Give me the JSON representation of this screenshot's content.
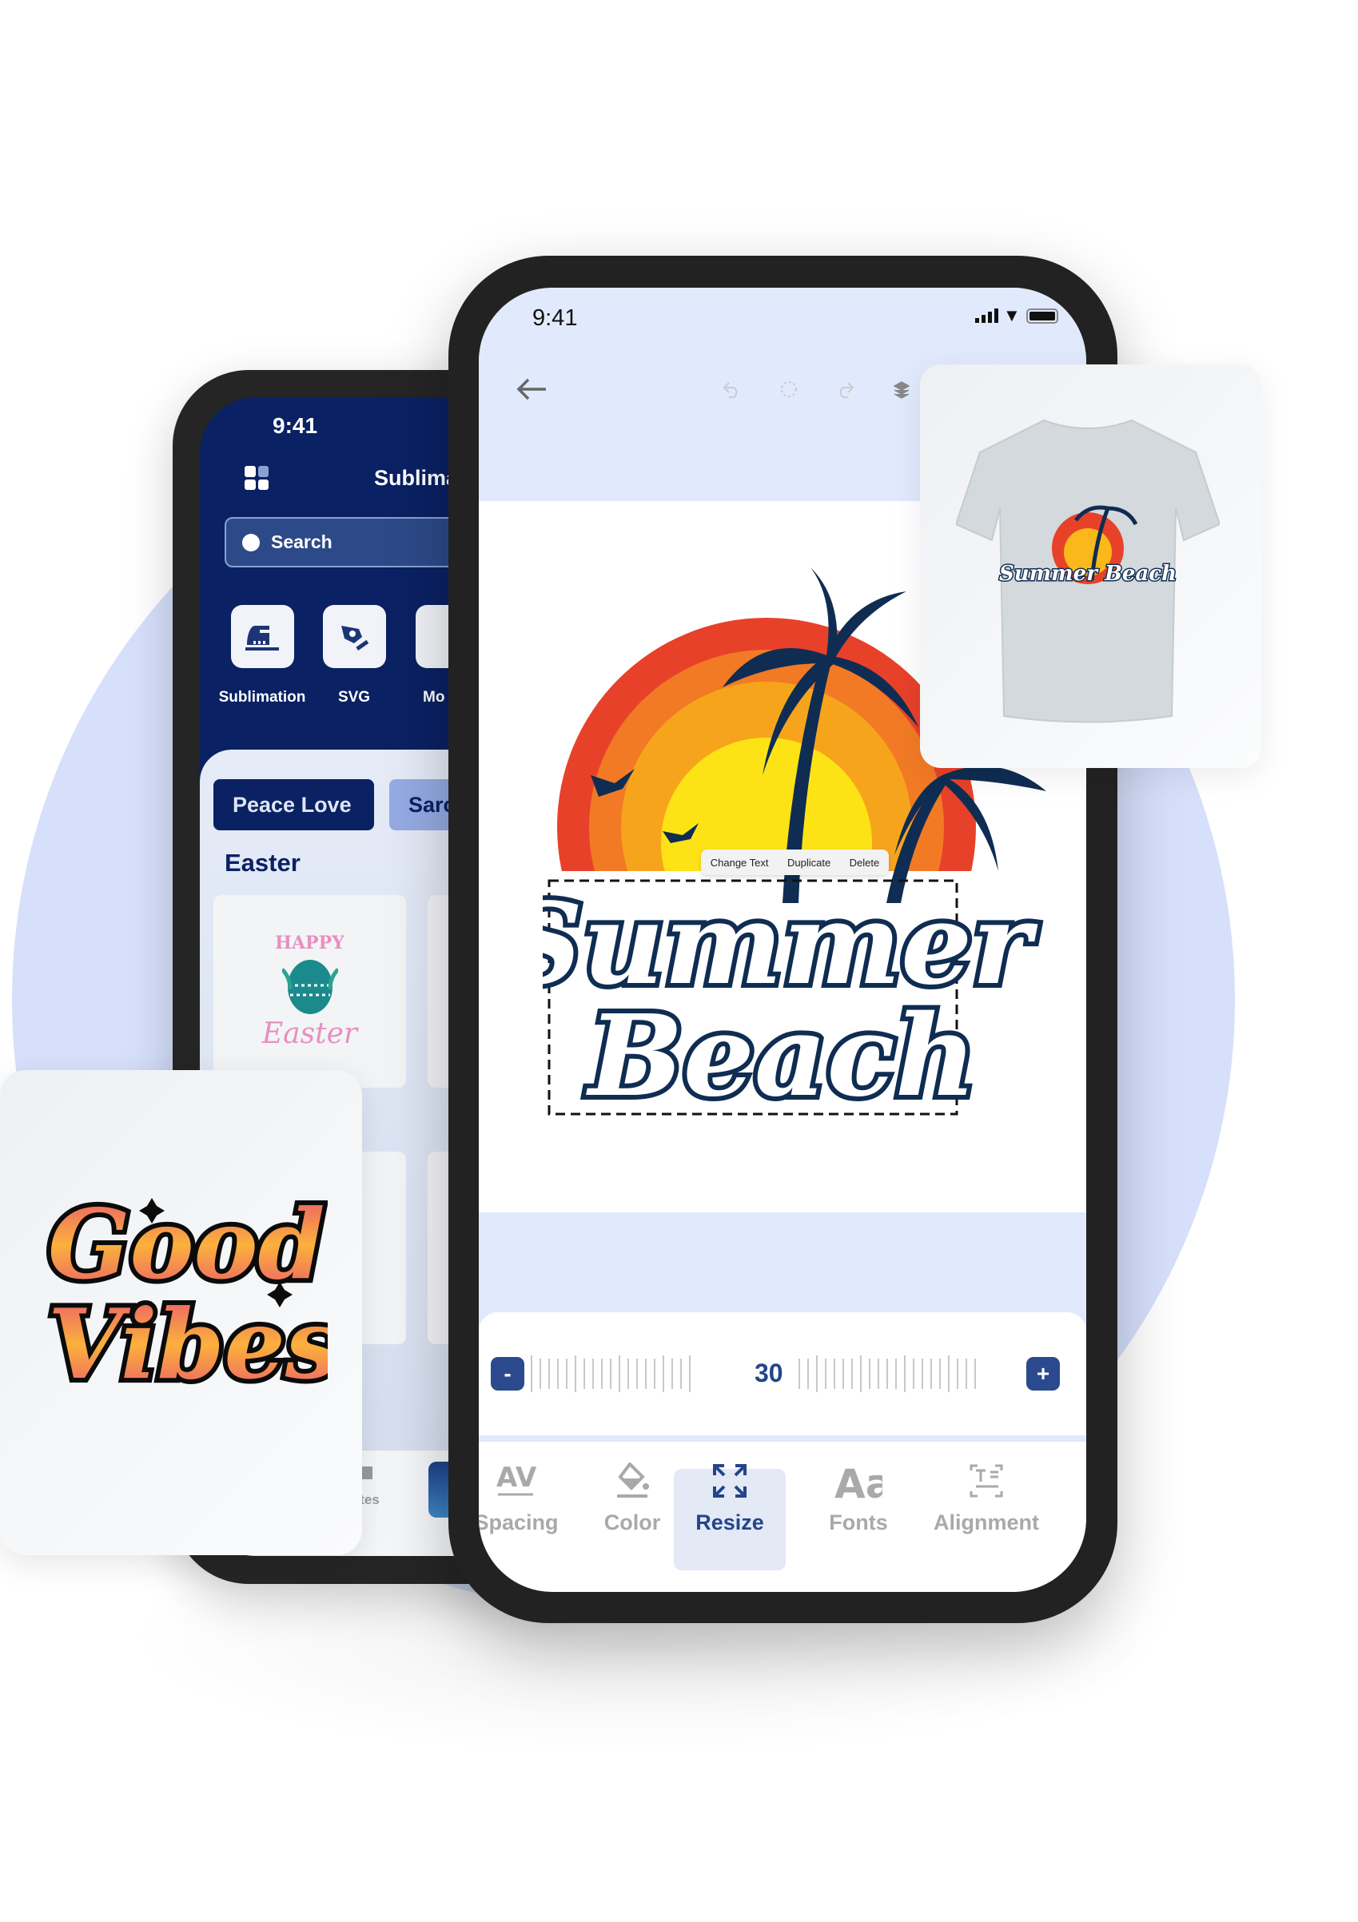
{
  "back_phone": {
    "status_time": "9:41",
    "app_title": "Sublima",
    "search_placeholder": "Search",
    "categories": [
      {
        "label": "Sublimation",
        "icon": "iron-icon"
      },
      {
        "label": "SVG",
        "icon": "pen-tool-icon"
      },
      {
        "label": "Mo",
        "icon": "mockup-icon"
      }
    ],
    "chips": [
      "Peace Love",
      "Sarc"
    ],
    "section_title": "Easter",
    "easter_card_text": {
      "top": "HAPPY",
      "bottom": "Easter"
    },
    "bottom_nav_label": "lates"
  },
  "front_phone": {
    "status_time": "9:41",
    "design": {
      "line1": "Summer",
      "line2": "Beach"
    },
    "context_menu": [
      "Change Text",
      "Duplicate",
      "Delete"
    ],
    "slider_value": "30",
    "minus_label": "-",
    "plus_label": "+",
    "tools": [
      {
        "label": "Spacing",
        "icon": "letter-spacing-icon",
        "active": false
      },
      {
        "label": "Color",
        "icon": "paint-bucket-icon",
        "active": false
      },
      {
        "label": "Resize",
        "icon": "resize-icon",
        "active": true
      },
      {
        "label": "Fonts",
        "icon": "font-icon",
        "active": false
      },
      {
        "label": "Alignment",
        "icon": "text-align-icon",
        "active": false
      }
    ]
  },
  "shirt_card": {
    "print_text": "Summer Beach"
  },
  "vibes_card": {
    "line1": "Good",
    "line2": "Vibes"
  },
  "colors": {
    "navy": "#0a2163",
    "accent": "#2b4a8e",
    "screen_bg": "#e1eafc",
    "circle_bg": "#d6e0fb"
  }
}
